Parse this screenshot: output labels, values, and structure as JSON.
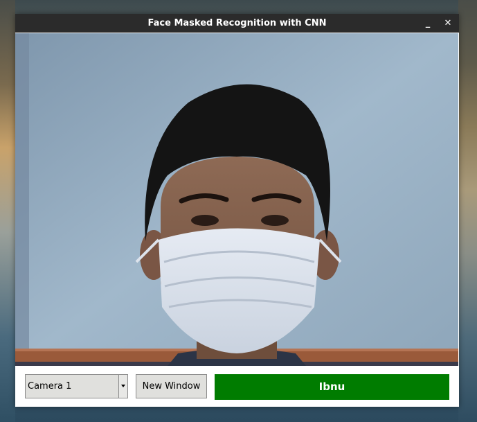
{
  "window": {
    "title": "Face Masked Recognition with CNN",
    "minimize_glyph": "_",
    "close_glyph": "✕"
  },
  "camera_feed": {
    "content": "webcam frame: person wearing surgical face mask"
  },
  "controls": {
    "camera_select": {
      "value": "Camera 1"
    },
    "new_window_label": "New Window",
    "result_label": "Ibnu",
    "result_color": "#007c00"
  },
  "colors": {
    "titlebar": "#2b2b2b",
    "button_bg": "#e0e0dd"
  }
}
